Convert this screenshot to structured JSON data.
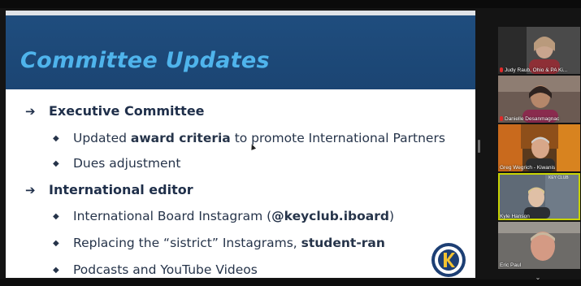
{
  "slide": {
    "title": "Committee Updates",
    "bullets": [
      {
        "arrow": "➔",
        "text": "Executive Committee"
      },
      {
        "text_parts": [
          "Updated ",
          "award criteria",
          " to promote International Partners"
        ]
      },
      {
        "text": "Dues adjustment"
      },
      {
        "arrow": "➔",
        "text": "International editor"
      },
      {
        "text_parts": [
          "International Board Instagram (",
          "@keyclub.iboard",
          ")"
        ]
      },
      {
        "text_parts": [
          "Replacing the “sistrict” Instagrams, ",
          "student-ran"
        ]
      },
      {
        "text": "Podcasts and YouTube Videos"
      }
    ],
    "bullet_symbol": "◆"
  },
  "participants": [
    {
      "name": "Judy Raub, Ohio & PA Ki...",
      "muted": true
    },
    {
      "name": "Danielle Desanmagnac",
      "muted": true
    },
    {
      "name": "Greg Wegrich - Kiwanis",
      "muted": false
    },
    {
      "name": "Kyle Hanson",
      "muted": false,
      "active_speaker": true,
      "overlay": "KEY CLUB"
    },
    {
      "name": "Eric Paul",
      "muted": false
    }
  ],
  "controls": {
    "scroll_down": "⌄"
  },
  "colors": {
    "header_bg": "#1b4573",
    "title": "#4fb4ec",
    "active_speaker_border": "#c8d400"
  }
}
